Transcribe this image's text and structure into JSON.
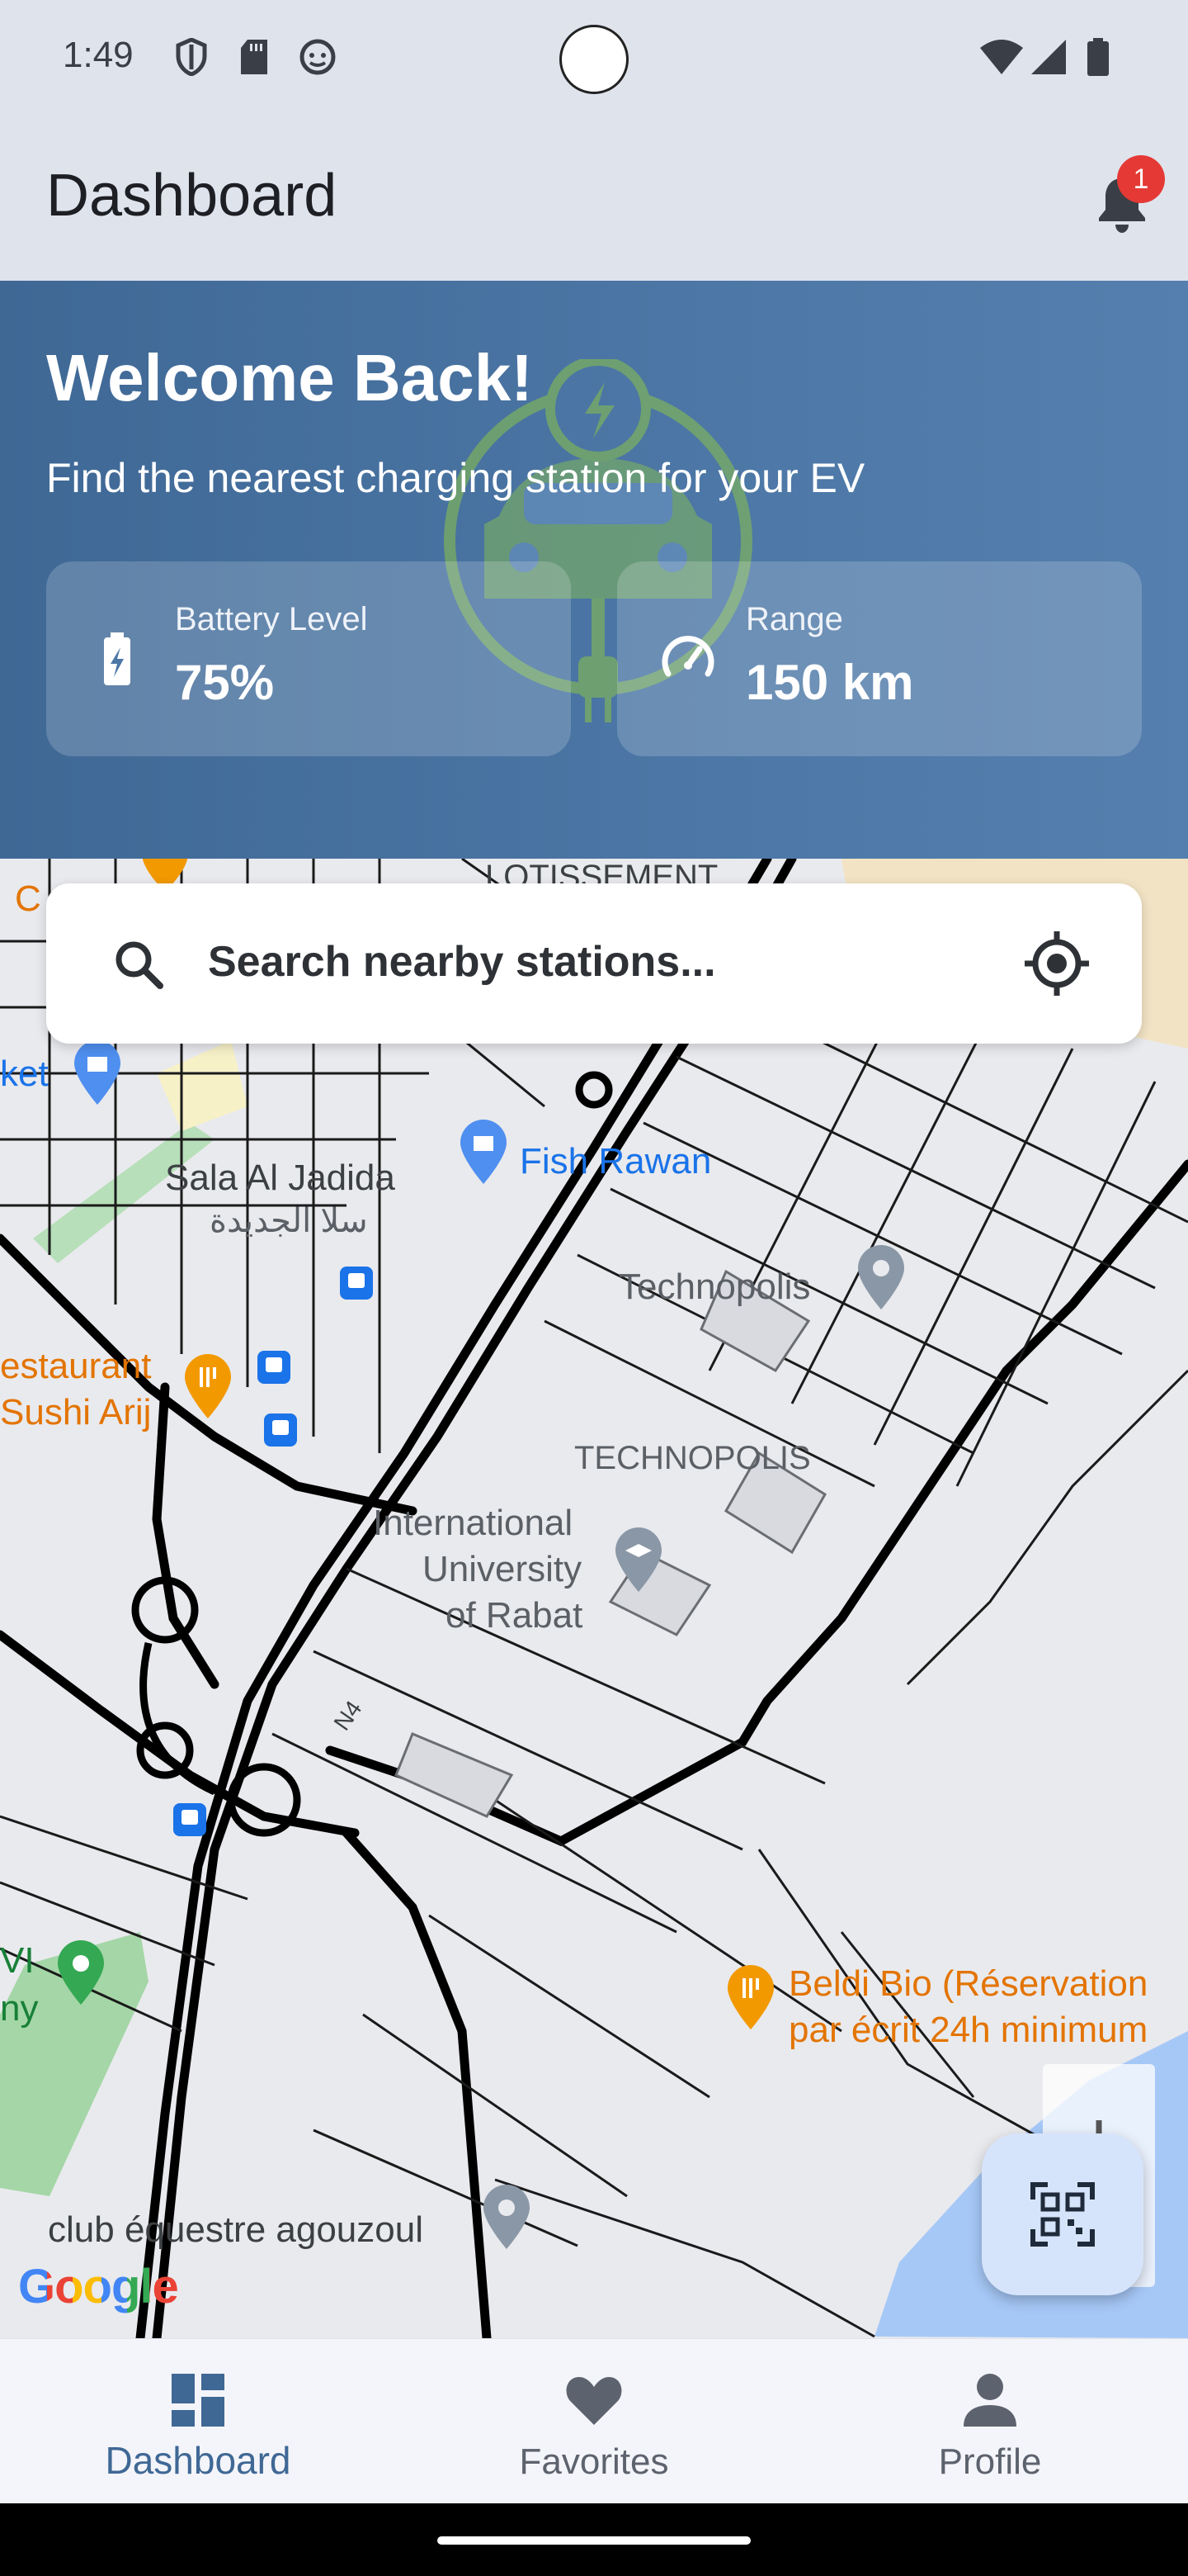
{
  "status_bar": {
    "time": "1:49"
  },
  "app_bar": {
    "title": "Dashboard",
    "notification_count": "1"
  },
  "hero": {
    "title": "Welcome Back!",
    "subtitle": "Find the nearest charging station for your EV",
    "stats": [
      {
        "label": "Battery Level",
        "value": "75%",
        "icon": "battery-icon"
      },
      {
        "label": "Range",
        "value": "150 km",
        "icon": "speedometer-icon"
      }
    ]
  },
  "search": {
    "placeholder": "Search nearby stations..."
  },
  "map": {
    "labels": {
      "lotissement": "LOTISSEMENT",
      "market": "ket",
      "c_partial": "C",
      "fish_rawan": "Fish Rawan",
      "sala_al_jadida": "Sala Al Jadida",
      "sala_arabic": "سلا الجديدة",
      "technopolis_poi": "Technopolis",
      "technopolis_area": "TECHNOPOLIS",
      "restaurant": "estaurant",
      "sushi": "Sushi Arij",
      "university_1": "International",
      "university_2": "University",
      "university_3": "of Rabat",
      "beldi_1": "Beldi Bio (Réservation",
      "beldi_2": "par écrit 24h minimum",
      "vi": "VI",
      "ny": "ny",
      "club": "club équestre agouzoul",
      "road_n4": "N4"
    },
    "attribution": "Google"
  },
  "bottom_nav": {
    "items": [
      {
        "label": "Dashboard",
        "icon": "dashboard-icon",
        "active": true
      },
      {
        "label": "Favorites",
        "icon": "heart-icon",
        "active": false
      },
      {
        "label": "Profile",
        "icon": "person-icon",
        "active": false
      }
    ]
  }
}
